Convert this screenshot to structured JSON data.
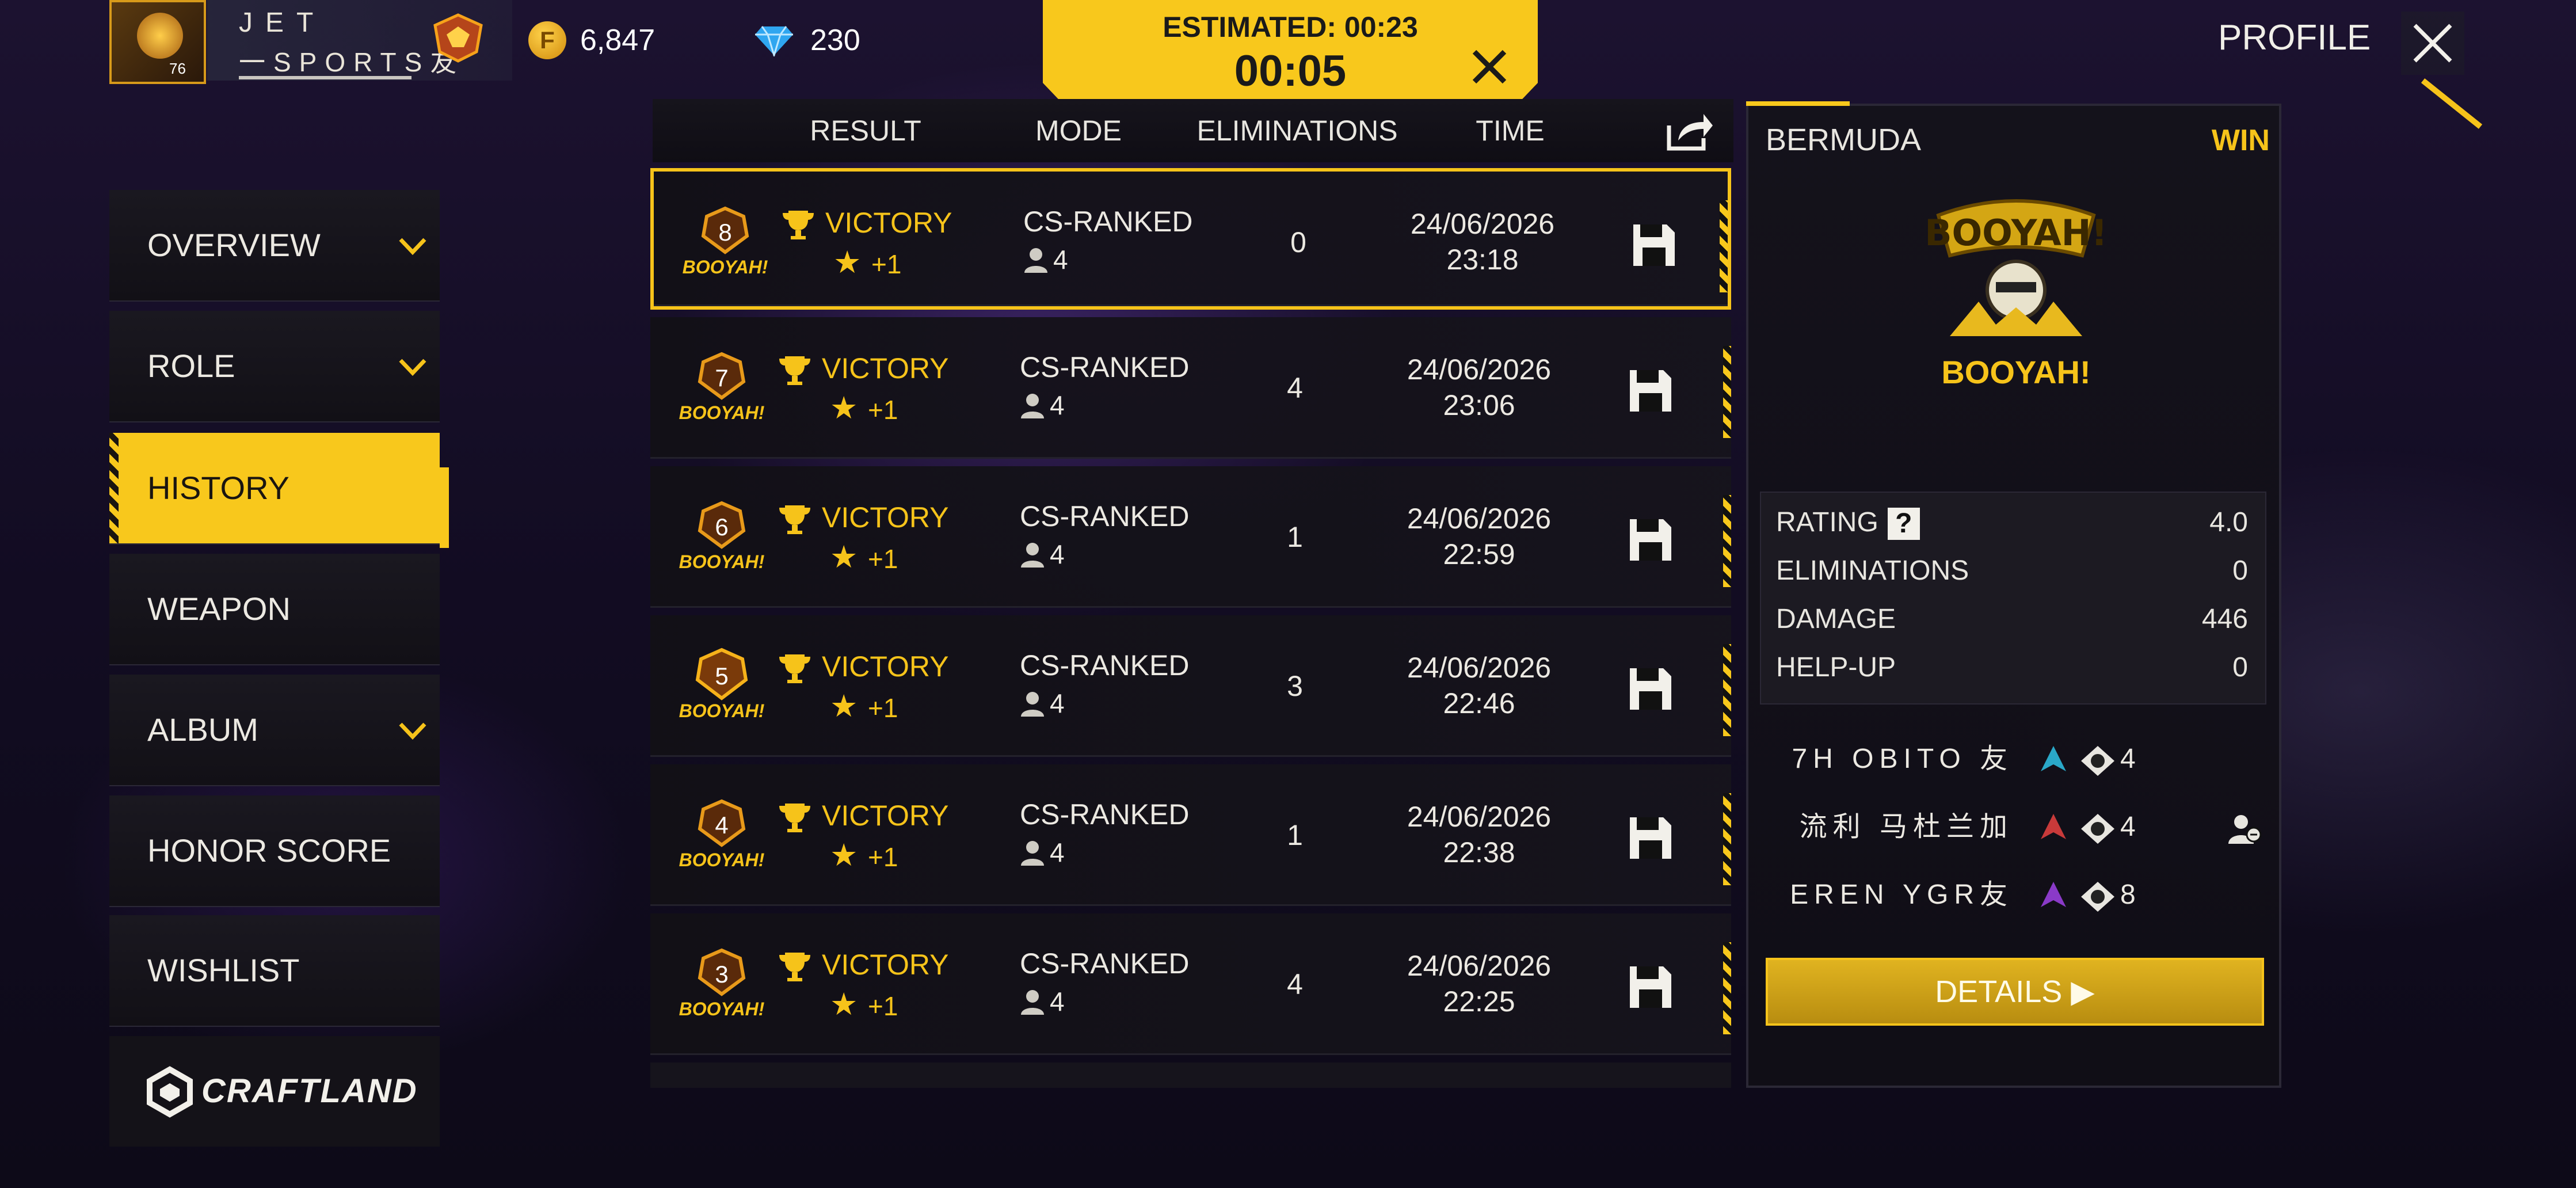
{
  "player": {
    "level": "76",
    "name_line1": "JET",
    "name_line2": "一SPORTS友"
  },
  "currency": {
    "coins": "6,847",
    "coin_symbol": "F",
    "diamonds": "230"
  },
  "timer": {
    "estimated": "ESTIMATED: 00:23",
    "elapsed": "00:05"
  },
  "header": {
    "profile_label": "PROFILE"
  },
  "menu": [
    {
      "label": "OVERVIEW",
      "chevron": true,
      "active": false
    },
    {
      "label": "ROLE",
      "chevron": true,
      "active": false
    },
    {
      "label": "HISTORY",
      "chevron": false,
      "active": true
    },
    {
      "label": "WEAPON",
      "chevron": false,
      "active": false
    },
    {
      "label": "ALBUM",
      "chevron": true,
      "active": false
    },
    {
      "label": "HONOR SCORE",
      "chevron": false,
      "active": false
    },
    {
      "label": "WISHLIST",
      "chevron": false,
      "active": false
    }
  ],
  "craftland_label": "CRAFTLAND",
  "table": {
    "headers": {
      "result": "RESULT",
      "mode": "MODE",
      "eliminations": "ELIMINATIONS",
      "time": "TIME"
    },
    "booyah_label": "BOOYAH!",
    "rows": [
      {
        "rank": "8",
        "result": "VICTORY",
        "stars": "+1",
        "mode": "CS-RANKED",
        "players": "4",
        "elims": "0",
        "date": "24/06/2026",
        "time": "23:18"
      },
      {
        "rank": "7",
        "result": "VICTORY",
        "stars": "+1",
        "mode": "CS-RANKED",
        "players": "4",
        "elims": "4",
        "date": "24/06/2026",
        "time": "23:06"
      },
      {
        "rank": "6",
        "result": "VICTORY",
        "stars": "+1",
        "mode": "CS-RANKED",
        "players": "4",
        "elims": "1",
        "date": "24/06/2026",
        "time": "22:59"
      },
      {
        "rank": "5",
        "result": "VICTORY",
        "stars": "+1",
        "mode": "CS-RANKED",
        "players": "4",
        "elims": "3",
        "date": "24/06/2026",
        "time": "22:46"
      },
      {
        "rank": "4",
        "result": "VICTORY",
        "stars": "+1",
        "mode": "CS-RANKED",
        "players": "4",
        "elims": "1",
        "date": "24/06/2026",
        "time": "22:38"
      },
      {
        "rank": "3",
        "result": "VICTORY",
        "stars": "+1",
        "mode": "CS-RANKED",
        "players": "4",
        "elims": "4",
        "date": "24/06/2026",
        "time": "22:25"
      }
    ]
  },
  "detail": {
    "map": "BERMUDA",
    "outcome": "WIN",
    "badge_text": "BOOYAH!",
    "stats": [
      {
        "label": "RATING",
        "value": "4.0",
        "help": "?"
      },
      {
        "label": "ELIMINATIONS",
        "value": "0"
      },
      {
        "label": "DAMAGE",
        "value": "446"
      },
      {
        "label": "HELP-UP",
        "value": "0"
      }
    ],
    "teammates": [
      {
        "name": "7H OBITO 友",
        "count": "4"
      },
      {
        "name": "流利 马杜兰加",
        "count": "4"
      },
      {
        "name": "EREN YGR友",
        "count": "8"
      }
    ],
    "details_button": "DETAILS"
  },
  "colors": {
    "accent": "#f6c31a",
    "panel": "#121016"
  }
}
